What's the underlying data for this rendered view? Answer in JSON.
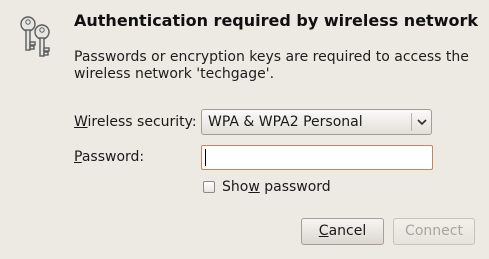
{
  "dialog": {
    "title": "Authentication required by wireless network",
    "message": "Passwords or encryption keys are required to access the wireless network 'techgage'."
  },
  "security": {
    "label_mnemonic": "W",
    "label_rest": "ireless security:",
    "selected_value": "WPA & WPA2 Personal"
  },
  "password": {
    "label_mnemonic": "P",
    "label_rest": "assword:",
    "value": ""
  },
  "show_password": {
    "label_before": "Sho",
    "label_mnemonic": "w",
    "label_after": " password",
    "checked": false
  },
  "buttons": {
    "cancel_mnemonic": "C",
    "cancel_rest": "ancel",
    "connect_label": "Connect"
  },
  "icons": {
    "dialog_icon": "keys-icon",
    "dropdown_icon": "chevron-down-icon"
  }
}
